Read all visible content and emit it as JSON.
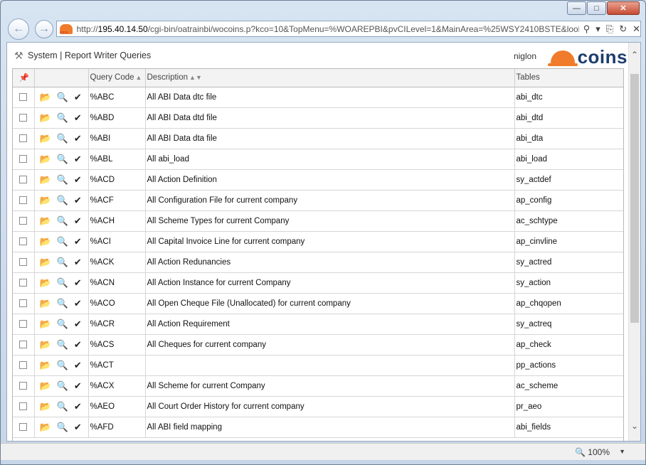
{
  "browser": {
    "url_host": "195.40.14.50",
    "url_prefix": "http://",
    "url_rest": "/cgi-bin/oatrainbi/wocoins.p?kco=10&TopMenu=%WOAREPBI&pvCILevel=1&MainArea=%25WSY2410BSTE&lookupl",
    "zoom": "100%"
  },
  "page": {
    "breadcrumb": "System | Report Writer Queries",
    "user": "niglon",
    "logo_text": "coins"
  },
  "table": {
    "headers": {
      "code": "Query Code",
      "description": "Description",
      "tables": "Tables"
    },
    "rows": [
      {
        "code": "%ABC",
        "description": "All ABI Data dtc file",
        "tables": "abi_dtc"
      },
      {
        "code": "%ABD",
        "description": "All ABI Data dtd file",
        "tables": "abi_dtd"
      },
      {
        "code": "%ABI",
        "description": "All ABI Data dta file",
        "tables": "abi_dta"
      },
      {
        "code": "%ABL",
        "description": "All abi_load",
        "tables": "abi_load"
      },
      {
        "code": "%ACD",
        "description": "All Action Definition",
        "tables": "sy_actdef"
      },
      {
        "code": "%ACF",
        "description": "All Configuration File for current company",
        "tables": "ap_config"
      },
      {
        "code": "%ACH",
        "description": "All Scheme Types for current Company",
        "tables": "ac_schtype"
      },
      {
        "code": "%ACI",
        "description": "All Capital Invoice Line for current company",
        "tables": "ap_cinvline"
      },
      {
        "code": "%ACK",
        "description": "All Action Redunancies",
        "tables": "sy_actred"
      },
      {
        "code": "%ACN",
        "description": "All Action Instance for current Company",
        "tables": "sy_action"
      },
      {
        "code": "%ACO",
        "description": "All Open Cheque File (Unallocated) for current company",
        "tables": "ap_chqopen"
      },
      {
        "code": "%ACR",
        "description": "All Action Requirement",
        "tables": "sy_actreq"
      },
      {
        "code": "%ACS",
        "description": "All Cheques for current company",
        "tables": "ap_check"
      },
      {
        "code": "%ACT",
        "description": "",
        "tables": "pp_actions"
      },
      {
        "code": "%ACX",
        "description": "All Scheme for current Company",
        "tables": "ac_scheme"
      },
      {
        "code": "%AEO",
        "description": "All Court Order History for current company",
        "tables": "pr_aeo"
      },
      {
        "code": "%AFD",
        "description": "All ABI field mapping",
        "tables": "abi_fields"
      }
    ]
  }
}
